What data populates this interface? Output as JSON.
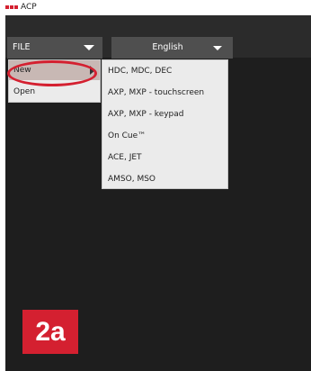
{
  "window": {
    "title": "ACP",
    "logo_text": "ACP",
    "brand_color": "#d42030"
  },
  "toolbar": {
    "file_label": "FILE",
    "language_label": "English"
  },
  "file_menu": {
    "items": [
      {
        "label": "New",
        "has_submenu": true,
        "highlighted": true
      },
      {
        "label": "Open",
        "has_submenu": false,
        "highlighted": false
      }
    ]
  },
  "new_submenu": {
    "items": [
      {
        "label": "HDC, MDC, DEC"
      },
      {
        "label": "AXP, MXP - touchscreen"
      },
      {
        "label": "AXP, MXP - keypad"
      },
      {
        "label": "On Cue™"
      },
      {
        "label": "ACE, JET"
      },
      {
        "label": "AMSO, MSO"
      }
    ]
  },
  "annotation": {
    "step_label": "2a"
  }
}
